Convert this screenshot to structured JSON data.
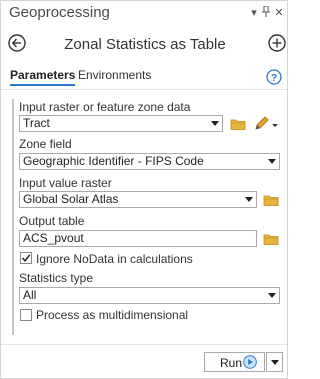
{
  "pane": {
    "title": "Geoprocessing",
    "controls": {
      "menu_icon": "chevron-down-icon",
      "pin_icon": "pin-icon",
      "close_icon": "close-icon"
    }
  },
  "tool": {
    "title": "Zonal Statistics as Table",
    "back_icon": "back-arrow-icon",
    "add_icon": "add-circle-icon"
  },
  "tabs": [
    {
      "label": "Parameters",
      "active": true
    },
    {
      "label": "Environments",
      "active": false
    }
  ],
  "help_icon": "help-icon",
  "params": {
    "zone_data": {
      "label": "Input raster or feature zone data",
      "value": "Tract"
    },
    "zone_field": {
      "label": "Zone field",
      "value": "Geographic Identifier - FIPS Code"
    },
    "value_raster": {
      "label": "Input value raster",
      "value": "Global Solar Atlas"
    },
    "output_table": {
      "label": "Output table",
      "value": "ACS_pvout"
    },
    "ignore_nodata": {
      "label": "Ignore NoData in calculations",
      "checked": true
    },
    "statistics_type": {
      "label": "Statistics type",
      "value": "All"
    },
    "multidimensional": {
      "label": "Process as multidimensional",
      "checked": false
    }
  },
  "run": {
    "label": "Run"
  },
  "colors": {
    "accent_blue": "#2a7ac7",
    "folder_yellow": "#e8b43c",
    "pencil_orange": "#e4a12b"
  }
}
